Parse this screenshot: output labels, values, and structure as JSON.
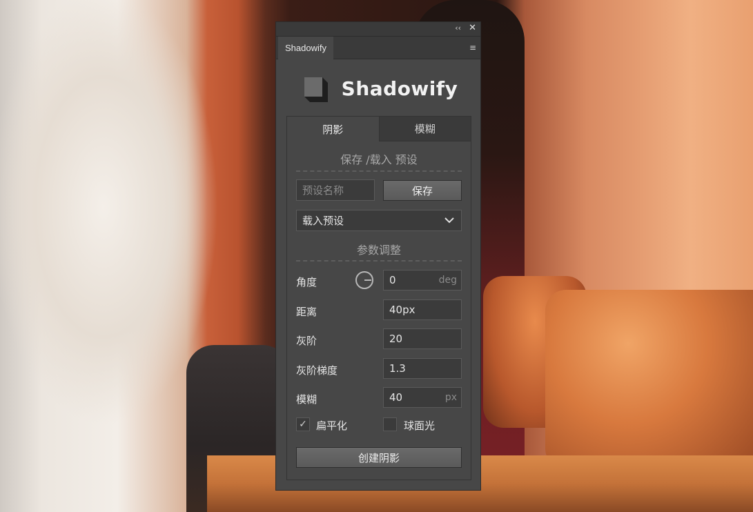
{
  "panel": {
    "tab_label": "Shadowify",
    "collapse_glyph": "‹‹",
    "close_glyph": "✕",
    "menu_glyph": "≡",
    "logo_text": "Shadowify"
  },
  "tabs": [
    {
      "label": "阴影",
      "active": true
    },
    {
      "label": "模糊",
      "active": false
    }
  ],
  "preset": {
    "section_title": "保存 /载入 预设",
    "name_placeholder": "预设名称",
    "save_label": "保存",
    "load_selected": "载入预设"
  },
  "params": {
    "section_title": "参数调整",
    "angle": {
      "label": "角度",
      "value": "0",
      "unit": "deg"
    },
    "distance": {
      "label": "距离",
      "value": "40px"
    },
    "gray_level": {
      "label": "灰阶",
      "value": "20"
    },
    "gray_gradient": {
      "label": "灰阶梯度",
      "value": "1.3"
    },
    "blur": {
      "label": "模糊",
      "value": "40",
      "unit": "px"
    }
  },
  "options": {
    "flatten": {
      "label": "扁平化",
      "checked": true,
      "check_glyph": "✓"
    },
    "sphere_light": {
      "label": "球面光",
      "checked": false
    }
  },
  "create_label": "创建阴影",
  "icons": [
    "collapse-icon",
    "close-icon",
    "panel-menu-icon",
    "shadowify-logo-icon",
    "chevron-down-icon",
    "angle-dial-icon",
    "checkmark-icon"
  ]
}
